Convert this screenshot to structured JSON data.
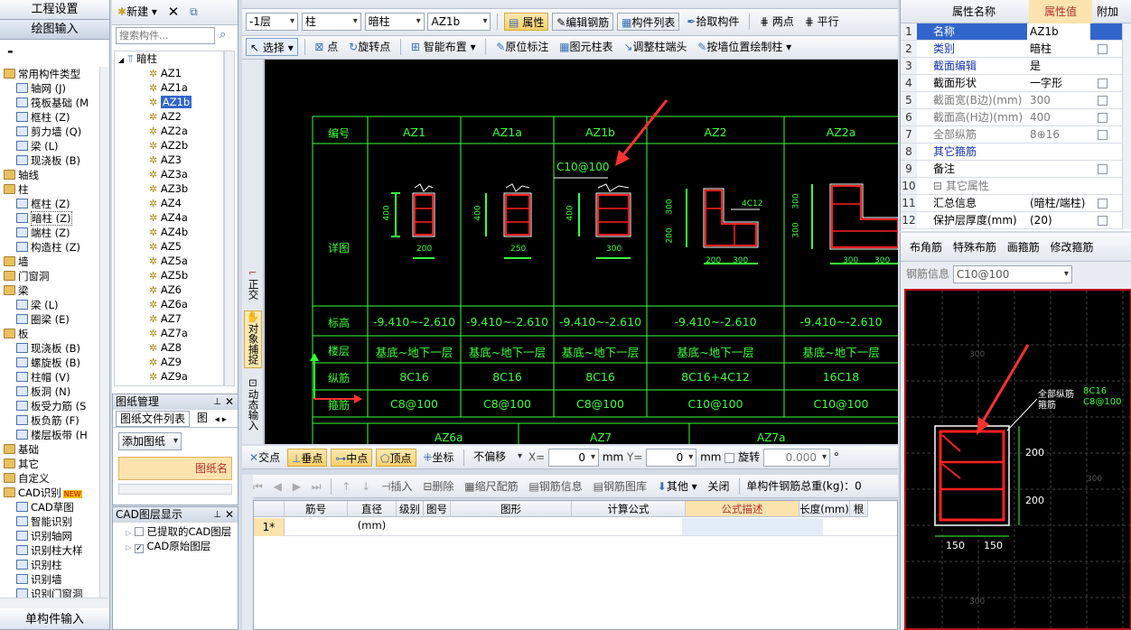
{
  "left_panel": {
    "project_settings": "工程设置",
    "drawing_input": "绘图输入",
    "minus": "-",
    "single_input": "单构件输入",
    "tree": [
      {
        "label": "常用构件类型",
        "level": 0,
        "type": "folder"
      },
      {
        "label": "轴网 (J)",
        "level": 1,
        "type": "comp"
      },
      {
        "label": "筏板基础 (M",
        "level": 1,
        "type": "comp"
      },
      {
        "label": "框柱 (Z)",
        "level": 1,
        "type": "comp"
      },
      {
        "label": "剪力墙 (Q)",
        "level": 1,
        "type": "comp"
      },
      {
        "label": "梁 (L)",
        "level": 1,
        "type": "comp"
      },
      {
        "label": "现浇板 (B)",
        "level": 1,
        "type": "comp"
      },
      {
        "label": "轴线",
        "level": 0,
        "type": "folder"
      },
      {
        "label": "柱",
        "level": 0,
        "type": "folder"
      },
      {
        "label": "框柱 (Z)",
        "level": 1,
        "type": "comp"
      },
      {
        "label": "暗柱 (Z)",
        "level": 1,
        "type": "comp",
        "selected": true
      },
      {
        "label": "端柱 (Z)",
        "level": 1,
        "type": "comp"
      },
      {
        "label": "构造柱 (Z)",
        "level": 1,
        "type": "comp"
      },
      {
        "label": "墙",
        "level": 0,
        "type": "folder"
      },
      {
        "label": "门窗洞",
        "level": 0,
        "type": "folder"
      },
      {
        "label": "梁",
        "level": 0,
        "type": "folder"
      },
      {
        "label": "梁 (L)",
        "level": 1,
        "type": "comp"
      },
      {
        "label": "圈梁 (E)",
        "level": 1,
        "type": "comp"
      },
      {
        "label": "板",
        "level": 0,
        "type": "folder"
      },
      {
        "label": "现浇板 (B)",
        "level": 1,
        "type": "comp"
      },
      {
        "label": "螺旋板 (B)",
        "level": 1,
        "type": "comp"
      },
      {
        "label": "柱帽 (V)",
        "level": 1,
        "type": "comp"
      },
      {
        "label": "板洞 (N)",
        "level": 1,
        "type": "comp"
      },
      {
        "label": "板受力筋 (S",
        "level": 1,
        "type": "comp"
      },
      {
        "label": "板负筋 (F)",
        "level": 1,
        "type": "comp"
      },
      {
        "label": "楼层板带 (H",
        "level": 1,
        "type": "comp"
      },
      {
        "label": "基础",
        "level": 0,
        "type": "folder"
      },
      {
        "label": "其它",
        "level": 0,
        "type": "folder"
      },
      {
        "label": "自定义",
        "level": 0,
        "type": "folder"
      },
      {
        "label": "CAD识别",
        "level": 0,
        "type": "folder",
        "badge": "NEW"
      },
      {
        "label": "CAD草图",
        "level": 1,
        "type": "comp"
      },
      {
        "label": "智能识别",
        "level": 1,
        "type": "comp"
      },
      {
        "label": "识别轴网",
        "level": 1,
        "type": "comp"
      },
      {
        "label": "识别柱大样",
        "level": 1,
        "type": "comp"
      },
      {
        "label": "识别柱",
        "level": 1,
        "type": "comp"
      },
      {
        "label": "识别墙",
        "level": 1,
        "type": "comp"
      },
      {
        "label": "识别门窗洞",
        "level": 1,
        "type": "comp"
      }
    ]
  },
  "comp_panel": {
    "new_label": "新建",
    "search_placeholder": "搜索构件...",
    "root": "暗柱",
    "items": [
      "AZ1",
      "AZ1a",
      "AZ1b",
      "AZ2",
      "AZ2a",
      "AZ2b",
      "AZ3",
      "AZ3a",
      "AZ3b",
      "AZ4",
      "AZ4a",
      "AZ4b",
      "AZ5",
      "AZ5a",
      "AZ5b",
      "AZ6",
      "AZ6a",
      "AZ7",
      "AZ7a",
      "AZ8",
      "AZ9",
      "AZ9a"
    ],
    "selected": "AZ1b"
  },
  "drawing_mgmt": {
    "title": "图纸管理",
    "tab1": "图纸文件列表",
    "tab2": "图",
    "add_drawing": "添加图纸",
    "col_name": "图纸名"
  },
  "cad_layers": {
    "title": "CAD图层显示",
    "items": [
      {
        "label": "已提取的CAD图层",
        "checked": false
      },
      {
        "label": "CAD原始图层",
        "checked": true
      }
    ]
  },
  "toolbar1": {
    "floor": "-1层",
    "type": "柱",
    "subtype": "暗柱",
    "comp": "AZ1b",
    "attr": "属性",
    "edit_rebar": "编辑钢筋",
    "comp_list": "构件列表",
    "pick": "拾取构件",
    "two_point": "两点",
    "parallel": "平行"
  },
  "toolbar2": {
    "select": "选择",
    "point": "点",
    "rotate_point": "旋转点",
    "smart": "智能布置",
    "orig_mark": "原位标注",
    "col_table": "图元柱表",
    "adjust_end": "调整柱端头",
    "wall_draw": "按墙位置绘制柱"
  },
  "side_tools": {
    "ortho": "正交",
    "snap": "对象捕捉",
    "dyn": "动态输入"
  },
  "cad_table": {
    "header": "编号",
    "detail": "详图",
    "elev": "标高",
    "floor": "楼层",
    "long": "纵筋",
    "stir": "箍筋",
    "columns": [
      {
        "name": "AZ1",
        "elev": "-9.410~-2.610",
        "floor": "基底~地下一层",
        "long": "8C16",
        "stir": "C8@100"
      },
      {
        "name": "AZ1a",
        "elev": "-9.410~-2.610",
        "floor": "基底~地下一层",
        "long": "8C16",
        "stir": "C8@100"
      },
      {
        "name": "AZ1b",
        "elev": "-9.410~-2.610",
        "floor": "基底~地下一层",
        "long": "8C16",
        "stir": "C8@100"
      },
      {
        "name": "AZ2",
        "elev": "-9.410~-2.610",
        "floor": "基底~地下一层",
        "long": "8C16+4C12",
        "stir": "C10@100"
      },
      {
        "name": "AZ2a",
        "elev": "-9.410~-2.610",
        "floor": "基底~地下一层",
        "long": "16C18",
        "stir": "C10@100"
      }
    ],
    "dims": {
      "az1_w": "200",
      "az1_h": "400",
      "az1a_w": "250",
      "az1a_h": "400",
      "az1b_w": "300",
      "az1b_h": "400",
      "az2_a": "200",
      "az2_b": "300",
      "az2_c": "300",
      "az2_d": "200",
      "az2_e": "4C12",
      "az2a_a": "300",
      "az2a_b": "300",
      "az2a_h": "300",
      "az2a_h2": "300"
    },
    "annotation": "C10@100",
    "row2": [
      "AZ6a",
      "AZ7",
      "AZ7a"
    ]
  },
  "snap_bar": {
    "intersect": "交点",
    "perp": "垂点",
    "mid": "中点",
    "vertex": "顶点",
    "coord": "坐标",
    "offset": "不偏移",
    "x_label": "X=",
    "x_val": "0",
    "mm1": "mm",
    "y_label": "Y=",
    "y_val": "0",
    "mm2": "mm",
    "rotate": "旋转",
    "rot_val": "0.000",
    "deg": "°"
  },
  "grid_bar": {
    "insert": "插入",
    "delete": "删除",
    "scale_rebar": "缩尺配筋",
    "rebar_info": "钢筋信息",
    "rebar_lib": "钢筋图库",
    "other": "其他",
    "close": "关闭",
    "total": "单构件钢筋总重(kg)：0"
  },
  "grid": {
    "headers": [
      "筋号",
      "直径(mm)",
      "级别",
      "图号",
      "图形",
      "计算公式",
      "公式描述",
      "长度(mm)",
      "根"
    ],
    "row1": "1*"
  },
  "props": {
    "h_name": "属性名称",
    "h_value": "属性值",
    "h_extra": "附加",
    "rows": [
      {
        "n": "1",
        "k": "名称",
        "v": "AZ1b",
        "style": "blue",
        "check": false,
        "sel": true
      },
      {
        "n": "2",
        "k": "类别",
        "v": "暗柱",
        "style": "blue",
        "check": true
      },
      {
        "n": "3",
        "k": "截面编辑",
        "v": "是",
        "style": "blue",
        "check": false
      },
      {
        "n": "4",
        "k": "截面形状",
        "v": "一字形",
        "style": "",
        "check": true
      },
      {
        "n": "5",
        "k": "截面宽(B边)(mm)",
        "v": "300",
        "style": "gray",
        "check": true
      },
      {
        "n": "6",
        "k": "截面高(H边)(mm)",
        "v": "400",
        "style": "gray",
        "check": true
      },
      {
        "n": "7",
        "k": "全部纵筋",
        "v": "8⊕16",
        "style": "gray",
        "check": true
      },
      {
        "n": "8",
        "k": "其它箍筋",
        "v": "",
        "style": "blue",
        "check": false
      },
      {
        "n": "9",
        "k": "备注",
        "v": "",
        "style": "",
        "check": true
      },
      {
        "n": "10",
        "k": "⊟ 其它属性",
        "v": "",
        "style": "gray",
        "check": false
      },
      {
        "n": "11",
        "k": "汇总信息",
        "v": "(暗柱/端柱)",
        "style": "",
        "check": true
      },
      {
        "n": "12",
        "k": "保护层厚度(mm)",
        "v": "(20)",
        "style": "",
        "check": true
      }
    ]
  },
  "rebar_panel": {
    "corner": "布角筋",
    "special": "特殊布筋",
    "draw_stir": "画箍筋",
    "modify": "修改箍筋",
    "info_label": "钢筋信息",
    "info_val": "C10@100",
    "all_long": "全部纵筋",
    "stir": "箍筋",
    "long_val": "8C16",
    "stir_val": "C8@100",
    "w1": "150",
    "w2": "150",
    "h1": "200",
    "h2": "200",
    "grid_a": "300",
    "grid_b": "300",
    "grid_c": "300"
  }
}
